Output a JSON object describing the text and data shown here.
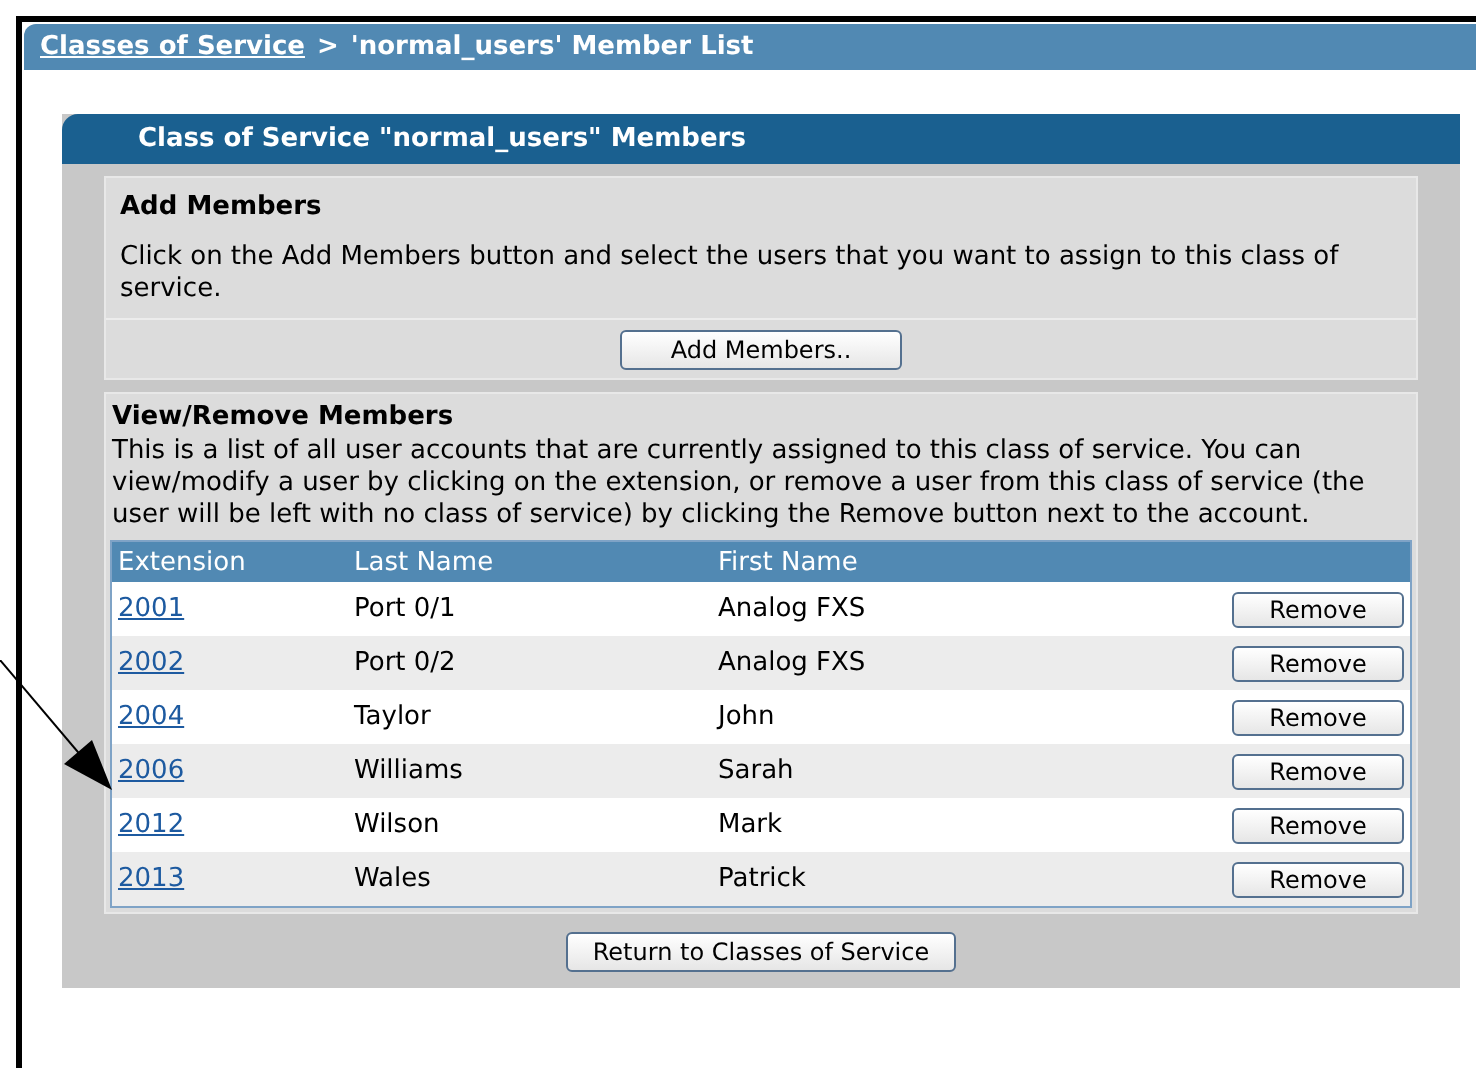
{
  "breadcrumb": {
    "link": "Classes of Service",
    "separator": ">",
    "current": "'normal_users' Member List"
  },
  "panel": {
    "title": "Class of Service \"normal_users\" Members",
    "add_section": {
      "heading": "Add Members",
      "description": "Click on the Add Members button and select the users that you want to assign to this class of service.",
      "button": "Add Members.."
    },
    "view_section": {
      "heading": "View/Remove Members",
      "description": "This is a list of all user accounts that are currently assigned to this class of service. You can view/modify a user by clicking on the extension, or remove a user from this class of service (the user will be left with no class of service) by clicking the Remove button next to the account.",
      "columns": [
        "Extension",
        "Last Name",
        "First Name"
      ],
      "rows": [
        {
          "extension": "2001",
          "last_name": "Port 0/1",
          "first_name": "Analog FXS",
          "action": "Remove"
        },
        {
          "extension": "2002",
          "last_name": "Port 0/2",
          "first_name": "Analog FXS",
          "action": "Remove"
        },
        {
          "extension": "2004",
          "last_name": "Taylor",
          "first_name": "John",
          "action": "Remove"
        },
        {
          "extension": "2006",
          "last_name": "Williams",
          "first_name": "Sarah",
          "action": "Remove"
        },
        {
          "extension": "2012",
          "last_name": "Wilson",
          "first_name": "Mark",
          "action": "Remove"
        },
        {
          "extension": "2013",
          "last_name": "Wales",
          "first_name": "Patrick",
          "action": "Remove"
        }
      ]
    },
    "return_button": "Return to Classes of Service"
  }
}
